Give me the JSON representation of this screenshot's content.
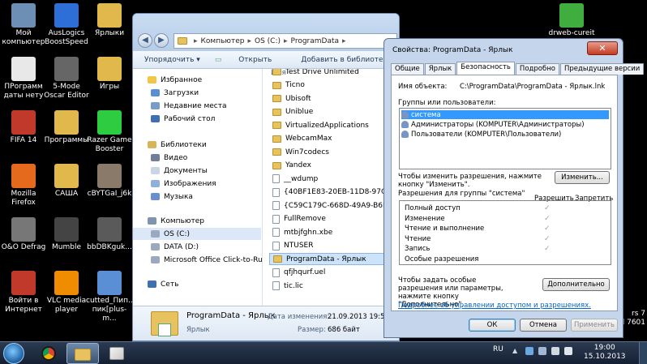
{
  "desktop": {
    "icons": [
      {
        "label": "Мой компьютер",
        "icon": "computer-icon",
        "color": "#6e8fb5"
      },
      {
        "label": "AusLogics BoostSpeed",
        "icon": "auslogics-icon",
        "color": "#2d6fd6"
      },
      {
        "label": "Ярлыки",
        "icon": "folder-icon",
        "color": "#e0b84c"
      },
      {
        "label": "ПРограмм даты нету",
        "icon": "window-icon",
        "color": "#e8e8e8"
      },
      {
        "label": "5-Mode Oscar Editor",
        "icon": "mouse-icon",
        "color": "#666666"
      },
      {
        "label": "Игры",
        "icon": "folder-icon",
        "color": "#e0b84c"
      },
      {
        "label": "FIFA 14",
        "icon": "fifa-icon",
        "color": "#c0392b"
      },
      {
        "label": "Программы",
        "icon": "folder-icon",
        "color": "#e0b84c"
      },
      {
        "label": "Razer Game Booster",
        "icon": "razer-icon",
        "color": "#2ecc40"
      },
      {
        "label": "Mozilla Firefox",
        "icon": "firefox-icon",
        "color": "#e66a1e"
      },
      {
        "label": "САША",
        "icon": "folder-icon",
        "color": "#e0b84c"
      },
      {
        "label": "cBYTGaI_j6k",
        "icon": "image-icon",
        "color": "#8a7a6a"
      },
      {
        "label": "O&O Defrag",
        "icon": "defrag-icon",
        "color": "#777777"
      },
      {
        "label": "Mumble",
        "icon": "mumble-icon",
        "color": "#444444"
      },
      {
        "label": "bbDBKguk...",
        "icon": "image-icon",
        "color": "#5a5a5a"
      },
      {
        "label": "Войти в Интернет",
        "icon": "internet-icon",
        "color": "#c0392b"
      },
      {
        "label": "VLC media player",
        "icon": "vlc-icon",
        "color": "#f08c00"
      },
      {
        "label": "cutted_Пип... пик[plus-m...",
        "icon": "file-icon",
        "color": "#5a8fd6"
      },
      {
        "label": "drweb-cureit",
        "icon": "drweb-icon",
        "color": "#3fae3f"
      }
    ],
    "watermark": [
      "rs 7",
      "d 7601"
    ]
  },
  "explorer": {
    "address": [
      "Компьютер",
      "OS (C:)",
      "ProgramData"
    ],
    "toolbar": {
      "organize": "Упорядочить ▾",
      "open": "Открыть",
      "add_to_library": "Добавить в библиотеку ▾"
    },
    "nav": {
      "favorites": "Избранное",
      "downloads": "Загрузки",
      "recent": "Недавние места",
      "desktop": "Рабочий стол",
      "libraries": "Библиотеки",
      "video": "Видео",
      "documents": "Документы",
      "images": "Изображения",
      "music": "Музыка",
      "computer": "Компьютер",
      "drive_c": "OS (C:)",
      "drive_d": "DATA (D:)",
      "click_to_run": "Microsoft Office Click-to-Run 2",
      "network": "Сеть"
    },
    "column_name": "Имя",
    "files": [
      {
        "name": "Test Drive Unlimited",
        "type": "folder"
      },
      {
        "name": "Ticno",
        "type": "folder"
      },
      {
        "name": "Ubisoft",
        "type": "folder"
      },
      {
        "name": "Uniblue",
        "type": "folder"
      },
      {
        "name": "VirtualizedApplications",
        "type": "folder"
      },
      {
        "name": "WebcamMax",
        "type": "folder"
      },
      {
        "name": "Win7codecs",
        "type": "folder"
      },
      {
        "name": "Yandex",
        "type": "folder"
      },
      {
        "name": "__wdump",
        "type": "doc"
      },
      {
        "name": "{40BF1E83-20EB-11D8-97C5-0",
        "type": "doc"
      },
      {
        "name": "{C59C179C-668D-49A9-B6EA-",
        "type": "doc"
      },
      {
        "name": "FullRemove",
        "type": "doc"
      },
      {
        "name": "mtbjfghn.xbe",
        "type": "doc"
      },
      {
        "name": "NTUSER",
        "type": "doc"
      },
      {
        "name": "ProgramData - Ярлык",
        "type": "folder"
      },
      {
        "name": "qfjhqurf.uel",
        "type": "doc"
      },
      {
        "name": "tic.lic",
        "type": "doc"
      }
    ],
    "details": {
      "name": "ProgramData - Ярлык",
      "type": "Ярлык",
      "modified_label": "Дата изменения:",
      "modified_value": "21.09.2013 19:57",
      "size_label": "Размер:",
      "size_value": "686 байт"
    }
  },
  "props": {
    "title": "Свойства: ProgramData - Ярлык",
    "tabs": [
      "Общие",
      "Ярлык",
      "Безопасность",
      "Подробно",
      "Предыдущие версии"
    ],
    "active_tab": 2,
    "object_label": "Имя объекта:",
    "object_value": "C:\\ProgramData\\ProgramData - Ярлык.lnk",
    "groups_label": "Группы или пользователи:",
    "groups": [
      "система",
      "Администраторы (KOMPUTER\\Администраторы)",
      "Пользователи (KOMPUTER\\Пользователи)"
    ],
    "change_hint": "Чтобы изменить разрешения, нажмите кнопку \"Изменить\".",
    "change_button": "Изменить...",
    "perm_for": "Разрешения для группы \"система\"",
    "allow": "Разрешить",
    "deny": "Запретить",
    "permissions": [
      {
        "name": "Полный доступ",
        "allow": true
      },
      {
        "name": "Изменение",
        "allow": true
      },
      {
        "name": "Чтение и выполнение",
        "allow": true
      },
      {
        "name": "Чтение",
        "allow": true
      },
      {
        "name": "Запись",
        "allow": true
      },
      {
        "name": "Особые разрешения",
        "allow": false
      }
    ],
    "special_hint": "Чтобы задать особые разрешения или параметры, нажмите кнопку \"Дополнительно\".",
    "advanced_button": "Дополнительно",
    "more_link": "Подробнее об управлении доступом и разрешениях.",
    "ok": "ОК",
    "cancel": "Отмена",
    "apply": "Применить",
    "check_glyph": "✓"
  },
  "taskbar": {
    "lang": "RU",
    "time": "19:00",
    "date": "15.10.2013"
  }
}
